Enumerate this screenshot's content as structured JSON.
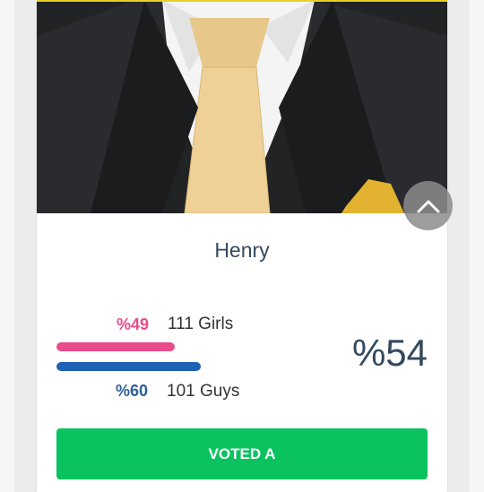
{
  "candidate": {
    "name": "Henry"
  },
  "stats": {
    "girls": {
      "percent_text": "%49",
      "label": "111 Girls",
      "fill_fraction": 0.49
    },
    "guys": {
      "percent_text": "%60",
      "label": "101 Guys",
      "fill_fraction": 0.6
    },
    "total_percent": "%54"
  },
  "actions": {
    "vote_label": "VOTED A",
    "collapse_icon": "chevron-up-icon"
  },
  "colors": {
    "girls": "#e84c8b",
    "guys": "#1c63b7",
    "vote_button": "#0ac35f",
    "title": "#34495e"
  }
}
